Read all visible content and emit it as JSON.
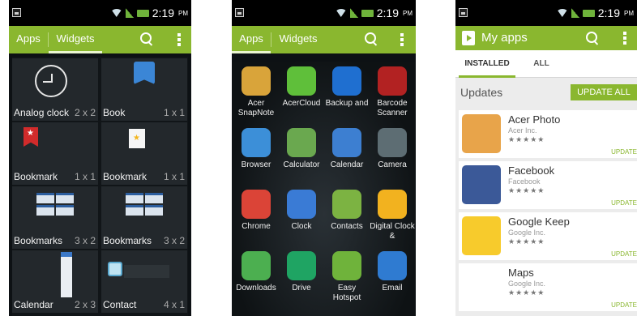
{
  "status_bar": {
    "time": "2:19",
    "ampm": "PM"
  },
  "widgets_screen": {
    "tabs": [
      "Apps",
      "Widgets"
    ],
    "active_tab": "Widgets",
    "widgets": [
      {
        "name": "Analog clock",
        "size": "2 x 2",
        "icon": "clock-icon"
      },
      {
        "name": "Book",
        "size": "1 x 1",
        "icon": "book-icon"
      },
      {
        "name": "Bookmark",
        "size": "1 x 1",
        "icon": "bookmark-icon"
      },
      {
        "name": "Bookmark",
        "size": "1 x 1",
        "icon": "bookmark-doc-icon"
      },
      {
        "name": "Bookmarks",
        "size": "3 x 2",
        "icon": "bookmarks-thumbnails"
      },
      {
        "name": "Bookmarks",
        "size": "3 x 2",
        "icon": "bookmarks-thumbnails"
      },
      {
        "name": "Calendar",
        "size": "2 x 3",
        "icon": "calendar-thumbnail"
      },
      {
        "name": "Contact",
        "size": "4 x 1",
        "icon": "contact-thumbnail"
      }
    ]
  },
  "apps_screen": {
    "tabs": [
      "Apps",
      "Widgets"
    ],
    "active_tab": "Apps",
    "apps": [
      {
        "label": "Acer SnapNote",
        "icon": "snapnote-icon",
        "color": "#d9a43a"
      },
      {
        "label": "AcerCloud",
        "icon": "cloud-icon",
        "color": "#5fbf3a"
      },
      {
        "label": "Backup and",
        "icon": "backup-icon",
        "color": "#1f6fd0"
      },
      {
        "label": "Barcode Scanner",
        "icon": "barcode-icon",
        "color": "#b22222"
      },
      {
        "label": "Browser",
        "icon": "globe-icon",
        "color": "#3c8fd8"
      },
      {
        "label": "Calculator",
        "icon": "calculator-icon",
        "color": "#6aa84f"
      },
      {
        "label": "Calendar",
        "icon": "calendar-icon",
        "color": "#3d7fd1"
      },
      {
        "label": "Camera",
        "icon": "camera-icon",
        "color": "#5d6d73"
      },
      {
        "label": "Chrome",
        "icon": "chrome-icon",
        "color": "#db4437"
      },
      {
        "label": "Clock",
        "icon": "clock-app-icon",
        "color": "#3a7bd5"
      },
      {
        "label": "Contacts",
        "icon": "contacts-icon",
        "color": "#7cb342"
      },
      {
        "label": "Digital Clock &",
        "icon": "weather-icon",
        "color": "#f2b21f"
      },
      {
        "label": "Downloads",
        "icon": "download-icon",
        "color": "#4caf50"
      },
      {
        "label": "Drive",
        "icon": "drive-icon",
        "color": "#1fa463"
      },
      {
        "label": "Easy Hotspot",
        "icon": "hotspot-icon",
        "color": "#6fb33b"
      },
      {
        "label": "Email",
        "icon": "email-icon",
        "color": "#2f7bd1"
      }
    ]
  },
  "play_store": {
    "title": "My apps",
    "tabs": [
      "INSTALLED",
      "ALL"
    ],
    "active_tab": "INSTALLED",
    "section_title": "Updates",
    "update_all_label": "UPDATE ALL",
    "apps": [
      {
        "name": "Acer Photo",
        "developer": "Acer Inc.",
        "stars": "★★★★★",
        "action": "UPDATE",
        "icon": "acer-photo-icon",
        "color": "#e8a44a"
      },
      {
        "name": "Facebook",
        "developer": "Facebook",
        "stars": "★★★★★",
        "action": "UPDATE",
        "icon": "facebook-icon",
        "color": "#3b5998"
      },
      {
        "name": "Google Keep",
        "developer": "Google Inc.",
        "stars": "★★★★★",
        "action": "UPDATE",
        "icon": "keep-icon",
        "color": "#f7cb2c"
      },
      {
        "name": "Maps",
        "developer": "Google Inc.",
        "stars": "★★★★★",
        "action": "UPDATE",
        "icon": "maps-icon",
        "color": "#ffffff"
      }
    ]
  }
}
